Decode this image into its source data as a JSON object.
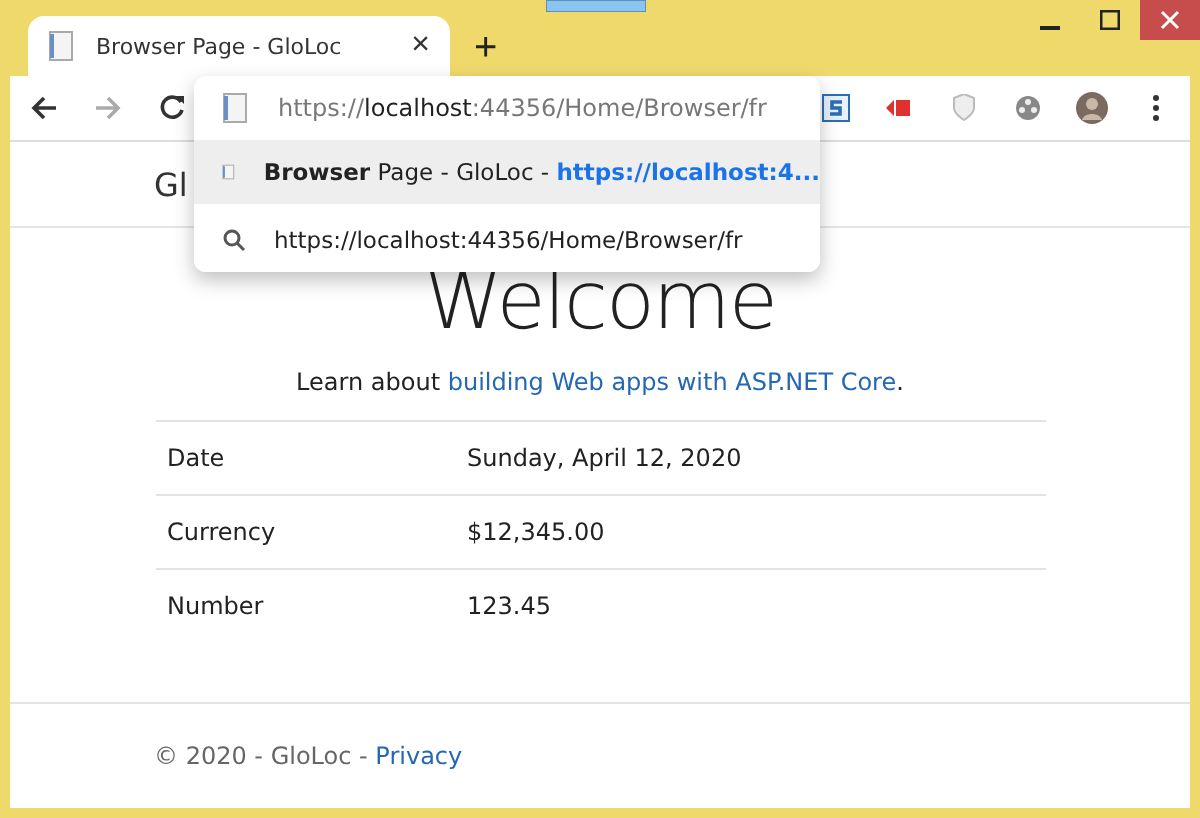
{
  "tab": {
    "title": "Browser Page - GloLoc",
    "close": "×",
    "selected": true
  },
  "new_tab": "+",
  "address_bar": {
    "scheme": "https://",
    "host": "localhost",
    "rest": ":44356/Home/Browser/fr"
  },
  "suggestions": [
    {
      "kind": "page",
      "text": "**Browser** Page - GloLoc - ",
      "url": "https://localhost:4...",
      "selected": true
    },
    {
      "kind": "search",
      "text": "https://localhost:44356/Home/Browser/fr",
      "selected": false
    }
  ],
  "navbar": {
    "brand": "Gl"
  },
  "heading": "Welcome",
  "intro": {
    "text": "Learn about ",
    "link": "building Web apps with ASP.NET Core",
    "end": "."
  },
  "table": {
    "rows": [
      {
        "label": "Date",
        "value": "Sunday, April 12, 2020"
      },
      {
        "label": "Currency",
        "value": "$12,345.00"
      },
      {
        "label": "Number",
        "value": "123.45"
      }
    ]
  },
  "footer": {
    "text": "© 2020 - GloLoc - ",
    "link": "Privacy"
  }
}
